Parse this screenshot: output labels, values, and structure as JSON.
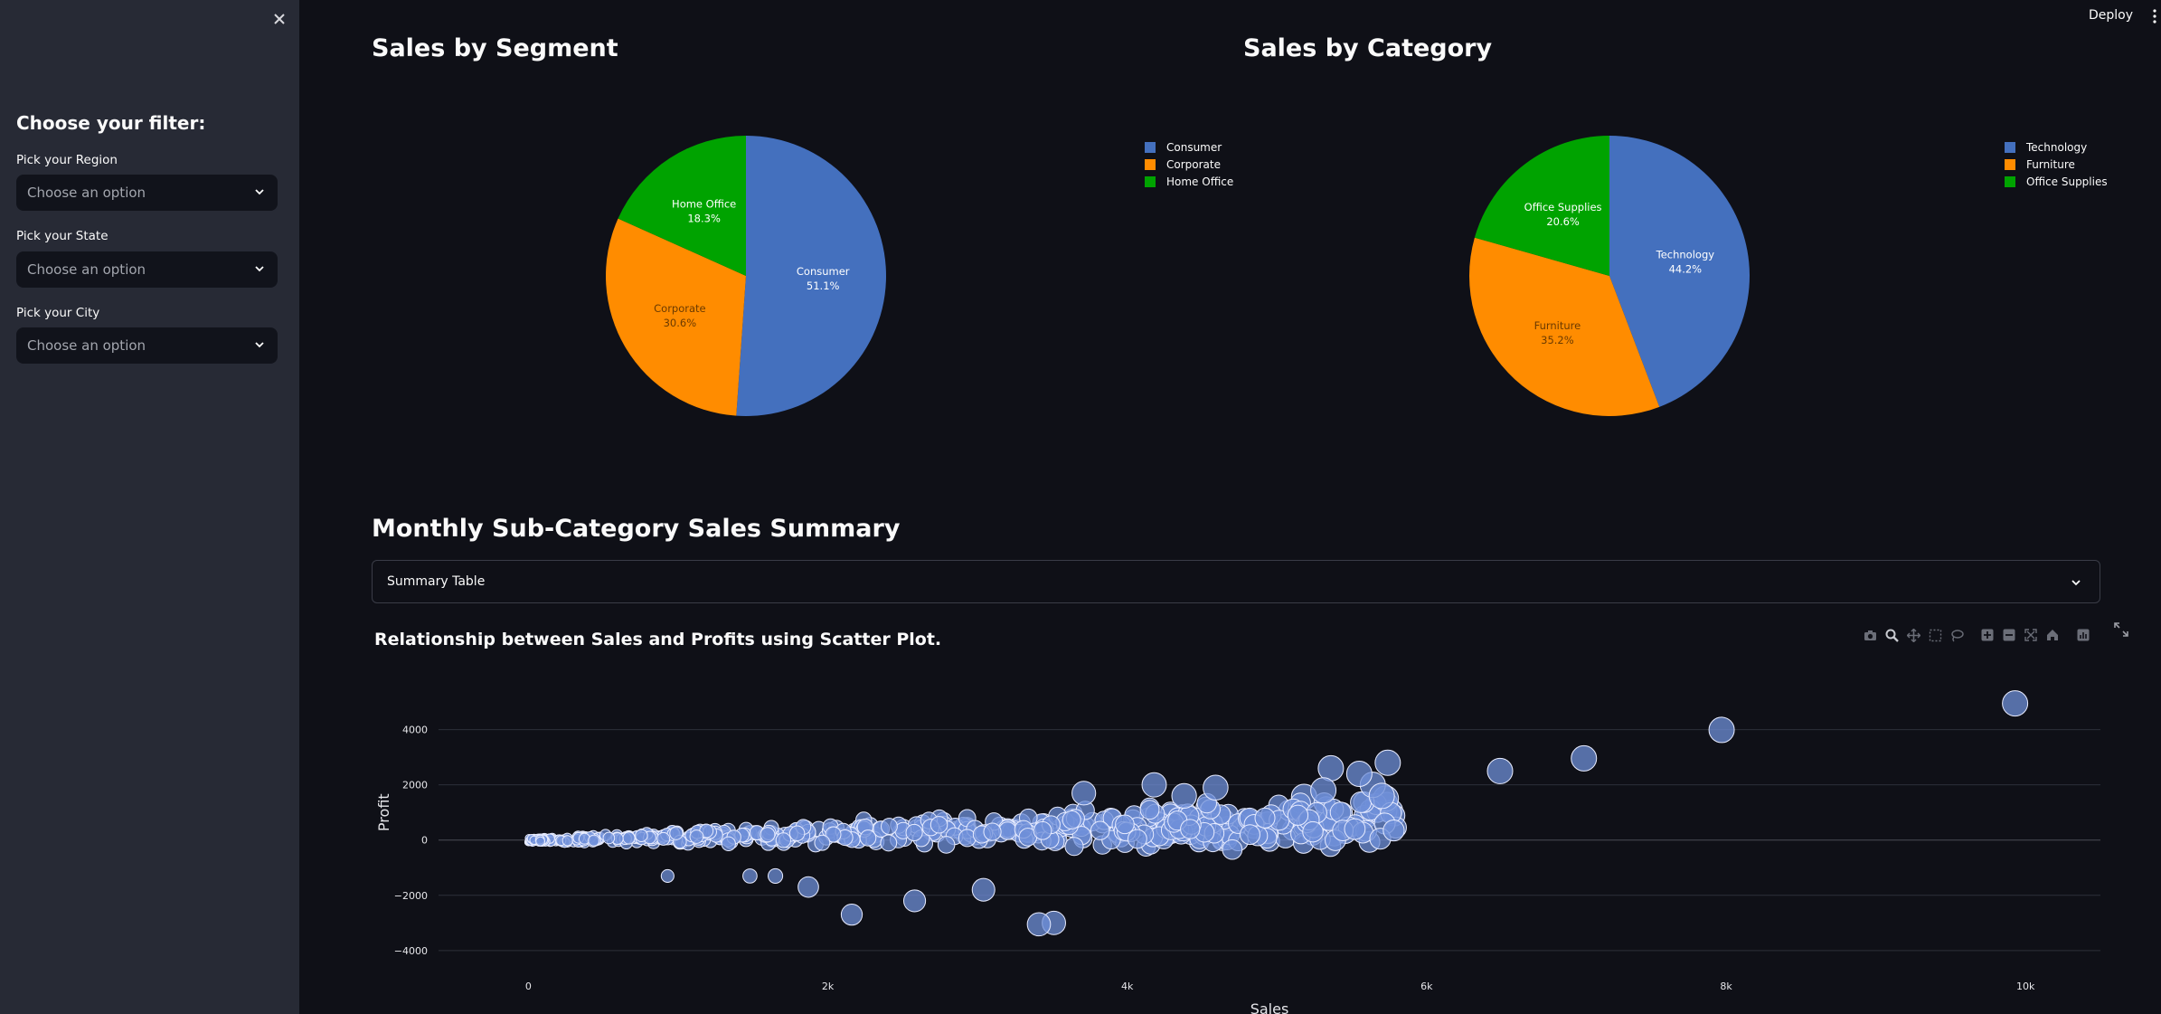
{
  "app": {
    "deploy_label": "Deploy"
  },
  "sidebar": {
    "title": "Choose your filter:",
    "filters": [
      {
        "label": "Pick your Region",
        "placeholder": "Choose an option"
      },
      {
        "label": "Pick your State",
        "placeholder": "Choose an option"
      },
      {
        "label": "Pick your City",
        "placeholder": "Choose an option"
      }
    ]
  },
  "segment": {
    "title": "Sales by Segment",
    "chart_data": {
      "type": "pie",
      "labels": [
        "Consumer",
        "Corporate",
        "Home Office"
      ],
      "values": [
        51.1,
        30.6,
        18.3
      ],
      "value_labels": [
        "51.1%",
        "30.6%",
        "18.3%"
      ],
      "legend": [
        "Consumer",
        "Corporate",
        "Home Office"
      ],
      "colors": [
        "#4470be",
        "#ff8c00",
        "#00a300"
      ]
    }
  },
  "category": {
    "title": "Sales by Category",
    "chart_data": {
      "type": "pie",
      "labels": [
        "Technology",
        "Furniture",
        "Office Supplies"
      ],
      "values": [
        44.2,
        35.2,
        20.6
      ],
      "value_labels": [
        "44.2%",
        "35.2%",
        "20.6%"
      ],
      "legend": [
        "Technology",
        "Furniture",
        "Office Supplies"
      ],
      "colors": [
        "#4470be",
        "#ff8c00",
        "#00a300"
      ]
    }
  },
  "summary": {
    "title": "Monthly Sub-Category Sales Summary",
    "expander_label": "Summary Table"
  },
  "scatter": {
    "title": "Relationship between Sales and Profits using Scatter Plot.",
    "modebar": [
      "camera-icon",
      "zoom-icon",
      "pan-icon",
      "box-select-icon",
      "lasso-icon",
      "zoom-in-icon",
      "zoom-out-icon",
      "autoscale-icon",
      "reset-axes-icon",
      "plotly-logo-icon"
    ],
    "chart_data": {
      "type": "scatter",
      "xlabel": "Sales",
      "ylabel": "Profit",
      "xlim": [
        -600,
        10500
      ],
      "ylim": [
        -4300,
        5200
      ],
      "xticks": [
        0,
        2000,
        4000,
        6000,
        8000,
        10000
      ],
      "xtick_labels": [
        "0",
        "2k",
        "4k",
        "6k",
        "8k",
        "10k"
      ],
      "yticks": [
        -4000,
        -2000,
        0,
        2000,
        4000
      ],
      "ytick_labels": [
        "−4000",
        "−2000",
        "0",
        "2000",
        "4000"
      ],
      "grid": true,
      "marker_color": "#6f8fd8",
      "highlighted_points": [
        [
          9930,
          4950
        ],
        [
          7970,
          3990
        ],
        [
          7050,
          2960
        ],
        [
          6490,
          2500
        ],
        [
          5740,
          2800
        ],
        [
          5640,
          2000
        ],
        [
          5700,
          1600
        ],
        [
          5360,
          2600
        ],
        [
          5550,
          2400
        ],
        [
          5310,
          1800
        ],
        [
          5520,
          400
        ],
        [
          5720,
          600
        ],
        [
          5690,
          50
        ],
        [
          5780,
          350
        ],
        [
          3510,
          -3000
        ],
        [
          3410,
          -3050
        ],
        [
          3040,
          -1800
        ],
        [
          2580,
          -2200
        ],
        [
          2160,
          -2700
        ],
        [
          1870,
          -1700
        ],
        [
          1650,
          -1300
        ],
        [
          1480,
          -1300
        ],
        [
          930,
          -1300
        ],
        [
          4180,
          2000
        ],
        [
          4380,
          1600
        ],
        [
          4590,
          1900
        ],
        [
          4920,
          800
        ],
        [
          5140,
          900
        ],
        [
          4820,
          200
        ],
        [
          5240,
          300
        ],
        [
          4420,
          400
        ],
        [
          4150,
          1100
        ],
        [
          3710,
          1700
        ]
      ],
      "cloud": {
        "x_range": [
          0,
          5800
        ],
        "trend_slope": 0.25,
        "count": 520
      }
    }
  }
}
